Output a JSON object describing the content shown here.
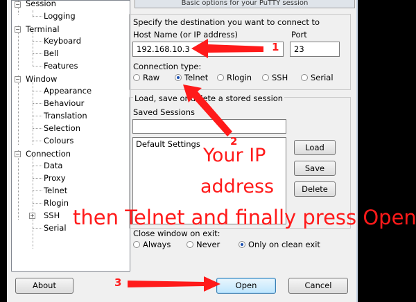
{
  "tree": {
    "items": [
      {
        "label": "Session"
      },
      {
        "label": "Logging"
      },
      {
        "label": "Terminal"
      },
      {
        "label": "Keyboard"
      },
      {
        "label": "Bell"
      },
      {
        "label": "Features"
      },
      {
        "label": "Window"
      },
      {
        "label": "Appearance"
      },
      {
        "label": "Behaviour"
      },
      {
        "label": "Translation"
      },
      {
        "label": "Selection"
      },
      {
        "label": "Colours"
      },
      {
        "label": "Connection"
      },
      {
        "label": "Data"
      },
      {
        "label": "Proxy"
      },
      {
        "label": "Telnet"
      },
      {
        "label": "Rlogin"
      },
      {
        "label": "SSH"
      },
      {
        "label": "Serial"
      }
    ]
  },
  "panel": {
    "header": "Basic options for your PuTTY session",
    "destination_label": "Specify the destination you want to connect to",
    "host_label": "Host Name (or IP address)",
    "host_value": "192.168.10.3",
    "port_label": "Port",
    "port_value": "23",
    "conn_type_label": "Connection type:",
    "conn_types": [
      "Raw",
      "Telnet",
      "Rlogin",
      "SSH",
      "Serial"
    ],
    "selected_conn_type": "Telnet",
    "session_group_label": "Load, save or delete a stored session",
    "saved_sessions_label": "Saved Sessions",
    "saved_sessions_value": "",
    "sessions_list": [
      "Default Settings"
    ],
    "load_label": "Load",
    "save_label": "Save",
    "delete_label": "Delete",
    "close_label": "Close window on exit:",
    "close_options": [
      "Always",
      "Never",
      "Only on clean exit"
    ],
    "selected_close": "Only on clean exit"
  },
  "buttons": {
    "about": "About",
    "open": "Open",
    "cancel": "Cancel"
  },
  "annotations": {
    "step1": "1",
    "step2": "2",
    "step3": "3",
    "your_ip": "Your IP",
    "address": "address",
    "instruction": "then Telnet and finally press Open"
  },
  "colors": {
    "annotation": "#ff1a1a",
    "background": "#000000",
    "window": "#f0f0f0"
  }
}
